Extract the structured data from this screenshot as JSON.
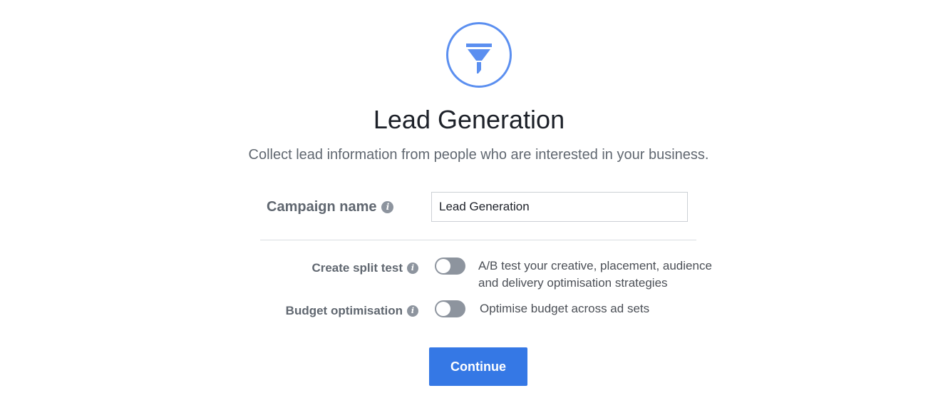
{
  "objective": {
    "icon": "funnel-icon",
    "title": "Lead Generation",
    "description": "Collect lead information from people who are interested in your business."
  },
  "campaign_name": {
    "label": "Campaign name",
    "value": "Lead Generation",
    "info_icon": "info-icon"
  },
  "split_test": {
    "label": "Create split test",
    "enabled": false,
    "description_line1": "A/B test your creative, placement, audience",
    "description_line2": "and delivery optimisation strategies"
  },
  "budget_optimisation": {
    "label": "Budget optimisation",
    "enabled": false,
    "description": "Optimise budget across ad sets"
  },
  "actions": {
    "continue_label": "Continue"
  },
  "colors": {
    "accent": "#3578e5",
    "icon_blue": "#5b8ff0",
    "toggle_off": "#8d949e",
    "title_text": "#1d2129",
    "secondary_text": "#606770"
  }
}
